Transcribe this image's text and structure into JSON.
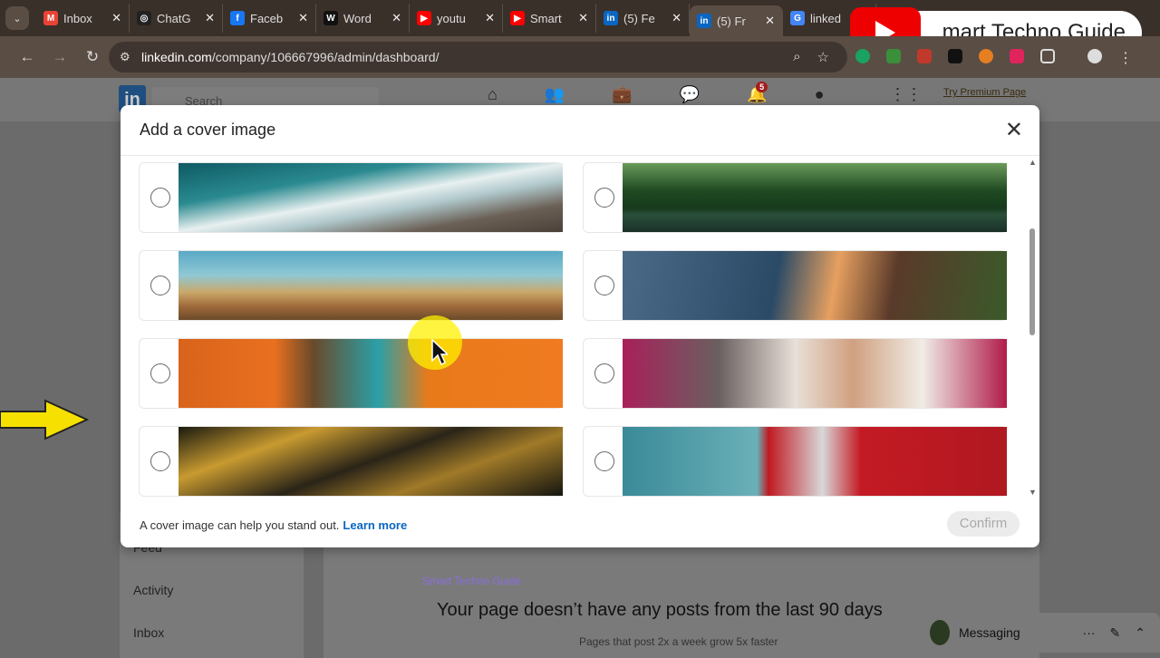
{
  "browser": {
    "tabs": [
      {
        "label": "Inbox",
        "icon": "gmail-icon",
        "color": "#ea4335"
      },
      {
        "label": "ChatG",
        "icon": "chatgpt-icon",
        "color": "#222222"
      },
      {
        "label": "Faceb",
        "icon": "facebook-icon",
        "color": "#1877f2"
      },
      {
        "label": "Word",
        "icon": "wordpress-icon",
        "color": "#111111"
      },
      {
        "label": "youtu",
        "icon": "youtube-icon",
        "color": "#ff0000"
      },
      {
        "label": "Smart",
        "icon": "youtube-icon",
        "color": "#ff0000"
      },
      {
        "label": "(5) Fe",
        "icon": "linkedin-icon",
        "color": "#0a66c2"
      },
      {
        "label": "(5) Fr",
        "icon": "linkedin-icon",
        "color": "#0a66c2",
        "active": true
      },
      {
        "label": "linked",
        "icon": "google-icon",
        "color": "#4285f4"
      }
    ],
    "url_domain": "linkedin.com",
    "url_path": "/company/106667996/admin/dashboard/",
    "fav_letters": [
      "M",
      "◎",
      "f",
      "W",
      "▶",
      "▶",
      "in",
      "in",
      "G"
    ]
  },
  "overlay": {
    "channel": "mart Techno Guide",
    "watermark": "Smart Techno Guide"
  },
  "linkedin": {
    "search_placeholder": "Search",
    "notifications": "5",
    "premium": "Try Premium Page",
    "sidebar": [
      "Feed",
      "Activity",
      "Inbox"
    ],
    "no_posts": "Your page doesn’t have any posts from the last 90 days",
    "tip": "Pages that post 2x a week grow 5x faster",
    "messaging": "Messaging"
  },
  "modal": {
    "title": "Add a cover image",
    "footer_text": "A cover image can help you stand out.",
    "learn_more": "Learn more",
    "confirm": "Confirm",
    "options": [
      "ocean-waves",
      "glass-house-forest",
      "wildflowers",
      "sunset-cliffs-waterfall",
      "orange-storefront",
      "palm-shadow-bougainvillea",
      "city-night",
      "red-teal-architecture"
    ]
  }
}
